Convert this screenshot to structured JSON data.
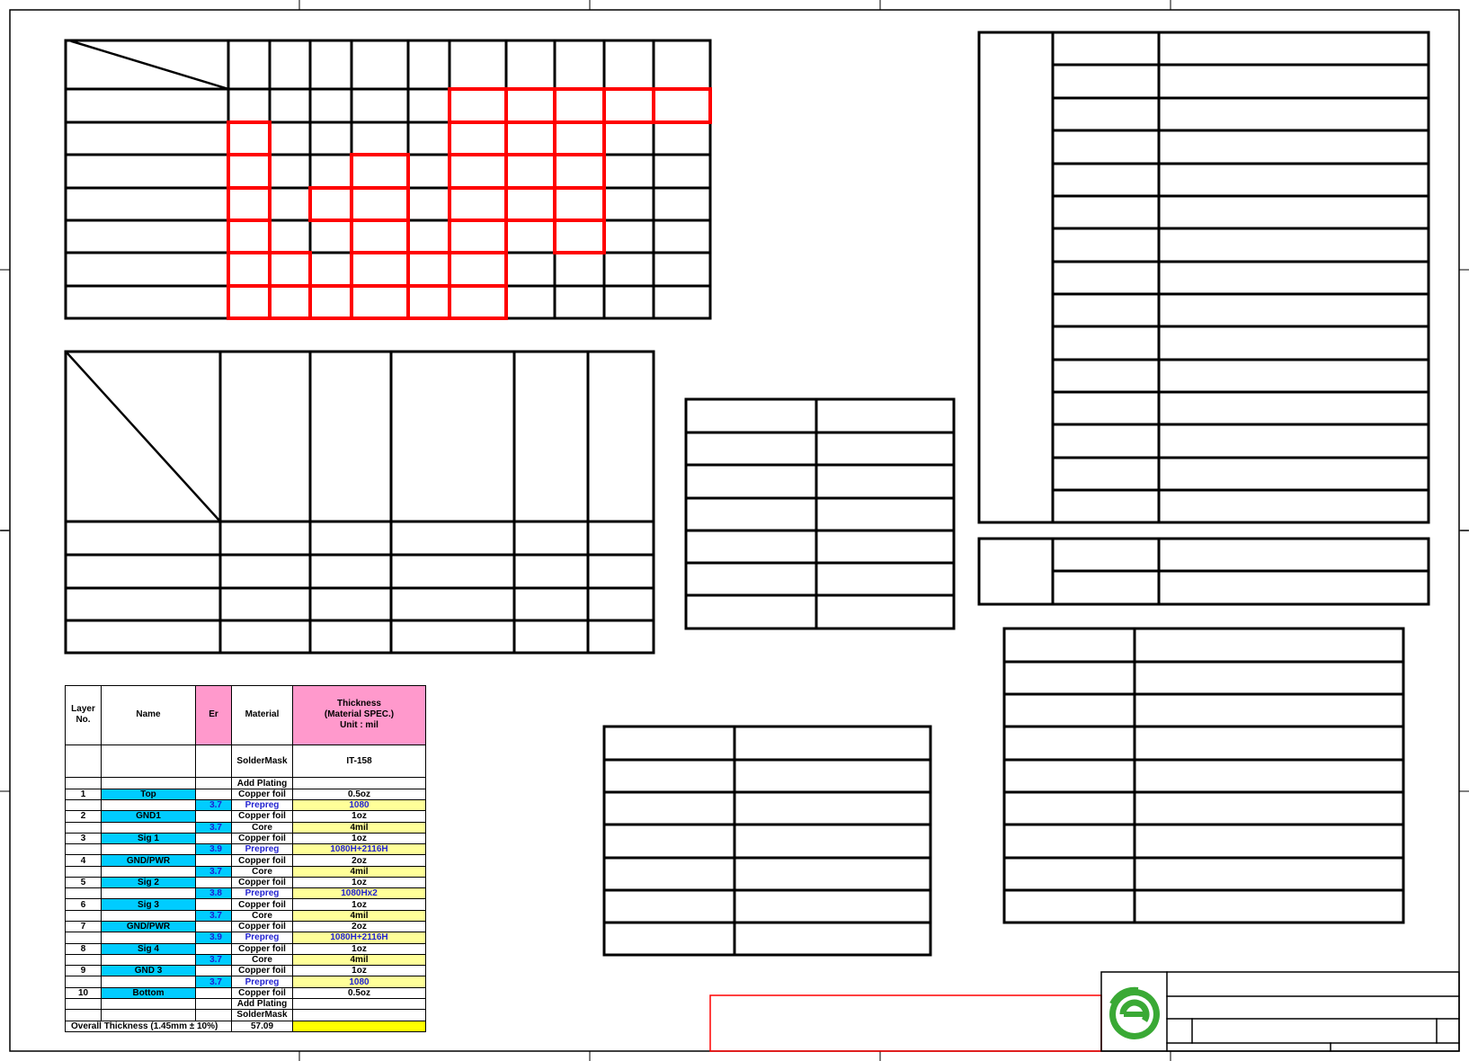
{
  "drawing_frame": {
    "logo_icon": "company-logo-icon",
    "colors": {
      "grid_red": "#ff0000",
      "line": "#000000",
      "logo_green": "#3aa935"
    }
  },
  "stackup": {
    "headers": {
      "layer_no": "Layer No.",
      "name": "Name",
      "er": "Er",
      "material": "Material",
      "thickness_l1": "Thickness",
      "thickness_l2": "(Material SPEC.)",
      "thickness_l3": "Unit : mil"
    },
    "rows": [
      {
        "layer": "",
        "name": "",
        "er": "",
        "material": "SolderMask",
        "thickness": "IT-158",
        "kind": "mask"
      },
      {
        "layer": "",
        "name": "",
        "er": "",
        "material": "Add Plating",
        "thickness": "",
        "kind": "plating"
      },
      {
        "layer": "1",
        "name": "Top",
        "er": "",
        "material": "Copper foil",
        "thickness": "0.5oz",
        "kind": "copper"
      },
      {
        "layer": "",
        "name": "",
        "er": "3.7",
        "material": "Prepreg",
        "thickness": "1080",
        "kind": "prepreg"
      },
      {
        "layer": "2",
        "name": "GND1",
        "er": "",
        "material": "Copper foil",
        "thickness": "1oz",
        "kind": "copper"
      },
      {
        "layer": "",
        "name": "",
        "er": "3.7",
        "material": "Core",
        "thickness": "4mil",
        "kind": "core"
      },
      {
        "layer": "3",
        "name": "Sig 1",
        "er": "",
        "material": "Copper foil",
        "thickness": "1oz",
        "kind": "copper"
      },
      {
        "layer": "",
        "name": "",
        "er": "3.9",
        "material": "Prepreg",
        "thickness": "1080H+2116H",
        "kind": "prepreg"
      },
      {
        "layer": "4",
        "name": "GND/PWR",
        "er": "",
        "material": "Copper foil",
        "thickness": "2oz",
        "kind": "copper"
      },
      {
        "layer": "",
        "name": "",
        "er": "3.7",
        "material": "Core",
        "thickness": "4mil",
        "kind": "core"
      },
      {
        "layer": "5",
        "name": "Sig 2",
        "er": "",
        "material": "Copper foil",
        "thickness": "1oz",
        "kind": "copper"
      },
      {
        "layer": "",
        "name": "",
        "er": "3.8",
        "material": "Prepreg",
        "thickness": "1080Hx2",
        "kind": "prepreg"
      },
      {
        "layer": "6",
        "name": "Sig 3",
        "er": "",
        "material": "Copper foil",
        "thickness": "1oz",
        "kind": "copper"
      },
      {
        "layer": "",
        "name": "",
        "er": "3.7",
        "material": "Core",
        "thickness": "4mil",
        "kind": "core"
      },
      {
        "layer": "7",
        "name": "GND/PWR",
        "er": "",
        "material": "Copper foil",
        "thickness": "2oz",
        "kind": "copper"
      },
      {
        "layer": "",
        "name": "",
        "er": "3.9",
        "material": "Prepreg",
        "thickness": "1080H+2116H",
        "kind": "prepreg"
      },
      {
        "layer": "8",
        "name": "Sig 4",
        "er": "",
        "material": "Copper foil",
        "thickness": "1oz",
        "kind": "copper"
      },
      {
        "layer": "",
        "name": "",
        "er": "3.7",
        "material": "Core",
        "thickness": "4mil",
        "kind": "core"
      },
      {
        "layer": "9",
        "name": "GND 3",
        "er": "",
        "material": "Copper foil",
        "thickness": "1oz",
        "kind": "copper"
      },
      {
        "layer": "",
        "name": "",
        "er": "3.7",
        "material": "Prepreg",
        "thickness": "1080",
        "kind": "prepreg"
      },
      {
        "layer": "10",
        "name": "Bottom",
        "er": "",
        "material": "Copper foil",
        "thickness": "0.5oz",
        "kind": "copper"
      },
      {
        "layer": "",
        "name": "",
        "er": "",
        "material": "Add Plating",
        "thickness": "",
        "kind": "plating"
      },
      {
        "layer": "",
        "name": "",
        "er": "",
        "material": "SolderMask",
        "thickness": "",
        "kind": "plating"
      }
    ],
    "overall_label": "Overall Thickness (1.45mm ± 10%)",
    "overall_value": "57.09"
  }
}
